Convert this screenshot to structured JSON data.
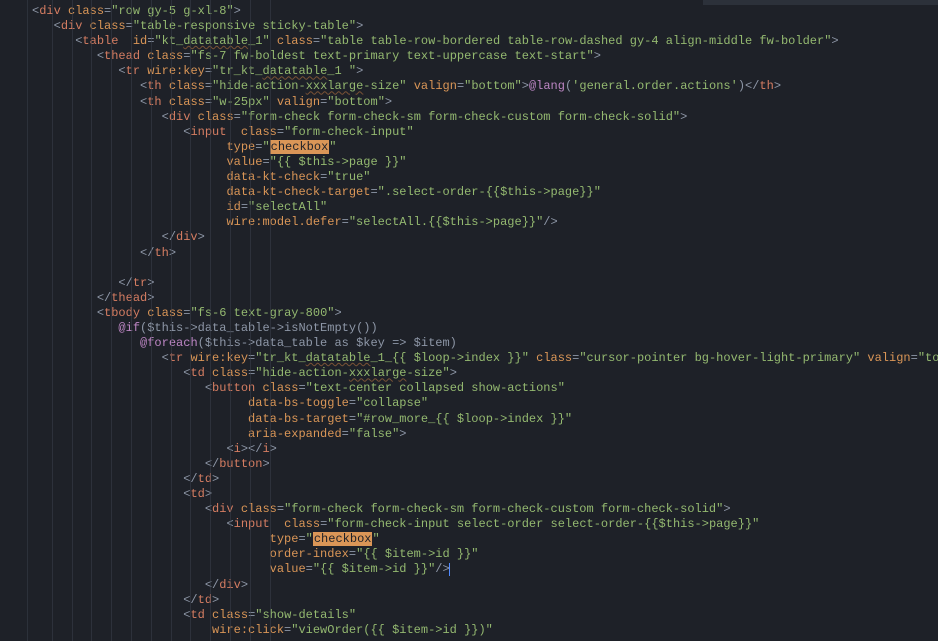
{
  "lines": [
    {
      "i": 0,
      "seg": [
        {
          "c": "p",
          "t": "<"
        },
        {
          "c": "tg",
          "t": "div"
        },
        {
          "c": "p",
          "t": " "
        },
        {
          "c": "at",
          "t": "class"
        },
        {
          "c": "op",
          "t": "="
        },
        {
          "c": "st",
          "t": "\"row gy-5 g-xl-8\""
        },
        {
          "c": "p",
          "t": ">"
        }
      ]
    },
    {
      "i": 1,
      "seg": [
        {
          "c": "p",
          "t": "<"
        },
        {
          "c": "tg",
          "t": "div"
        },
        {
          "c": "p",
          "t": " "
        },
        {
          "c": "at",
          "t": "class"
        },
        {
          "c": "op",
          "t": "="
        },
        {
          "c": "st",
          "t": "\"table-responsive sticky-table\""
        },
        {
          "c": "p",
          "t": ">"
        }
      ]
    },
    {
      "i": 2,
      "seg": [
        {
          "c": "p",
          "t": "<"
        },
        {
          "c": "tg",
          "t": "table"
        },
        {
          "c": "p",
          "t": "  "
        },
        {
          "c": "at",
          "t": "id"
        },
        {
          "c": "op",
          "t": "="
        },
        {
          "c": "st",
          "t": "\"kt_"
        },
        {
          "c": "st wavy",
          "t": "datatable"
        },
        {
          "c": "st",
          "t": "_1\""
        },
        {
          "c": "p",
          "t": " "
        },
        {
          "c": "at",
          "t": "class"
        },
        {
          "c": "op",
          "t": "="
        },
        {
          "c": "st",
          "t": "\"table table-row-bordered table-row-dashed gy-4 align-middle fw-bolder\""
        },
        {
          "c": "p",
          "t": ">"
        }
      ]
    },
    {
      "i": 3,
      "seg": [
        {
          "c": "p",
          "t": "<"
        },
        {
          "c": "tg",
          "t": "thead"
        },
        {
          "c": "p",
          "t": " "
        },
        {
          "c": "at",
          "t": "class"
        },
        {
          "c": "op",
          "t": "="
        },
        {
          "c": "st",
          "t": "\"fs-7 fw-boldest text-primary text-uppercase text-start\""
        },
        {
          "c": "p",
          "t": ">"
        }
      ]
    },
    {
      "i": 4,
      "seg": [
        {
          "c": "p",
          "t": "<"
        },
        {
          "c": "tg",
          "t": "tr"
        },
        {
          "c": "p",
          "t": " "
        },
        {
          "c": "at",
          "t": "wire:key"
        },
        {
          "c": "op",
          "t": "="
        },
        {
          "c": "st",
          "t": "\"tr_kt_"
        },
        {
          "c": "st wavy",
          "t": "datatable"
        },
        {
          "c": "st",
          "t": "_1 \""
        },
        {
          "c": "p",
          "t": ">"
        }
      ]
    },
    {
      "i": 5,
      "seg": [
        {
          "c": "p",
          "t": "<"
        },
        {
          "c": "tg",
          "t": "th"
        },
        {
          "c": "p",
          "t": " "
        },
        {
          "c": "at",
          "t": "class"
        },
        {
          "c": "op",
          "t": "="
        },
        {
          "c": "st",
          "t": "\"hide-action-"
        },
        {
          "c": "st wavy",
          "t": "xxxlarge"
        },
        {
          "c": "st",
          "t": "-size\""
        },
        {
          "c": "p",
          "t": " "
        },
        {
          "c": "at",
          "t": "valign"
        },
        {
          "c": "op",
          "t": "="
        },
        {
          "c": "st",
          "t": "\"bottom\""
        },
        {
          "c": "p",
          "t": ">"
        },
        {
          "c": "bl",
          "t": "@lang"
        },
        {
          "c": "p",
          "t": "("
        },
        {
          "c": "st",
          "t": "'general.order.actions'"
        },
        {
          "c": "p",
          "t": ")</"
        },
        {
          "c": "tg",
          "t": "th"
        },
        {
          "c": "p",
          "t": ">"
        }
      ]
    },
    {
      "i": 5,
      "seg": [
        {
          "c": "p",
          "t": "<"
        },
        {
          "c": "tg",
          "t": "th"
        },
        {
          "c": "p",
          "t": " "
        },
        {
          "c": "at",
          "t": "class"
        },
        {
          "c": "op",
          "t": "="
        },
        {
          "c": "st",
          "t": "\"w-25px\""
        },
        {
          "c": "p",
          "t": " "
        },
        {
          "c": "at",
          "t": "valign"
        },
        {
          "c": "op",
          "t": "="
        },
        {
          "c": "st",
          "t": "\"bottom\""
        },
        {
          "c": "p",
          "t": ">"
        }
      ]
    },
    {
      "i": 6,
      "seg": [
        {
          "c": "p",
          "t": "<"
        },
        {
          "c": "tg",
          "t": "div"
        },
        {
          "c": "p",
          "t": " "
        },
        {
          "c": "at",
          "t": "class"
        },
        {
          "c": "op",
          "t": "="
        },
        {
          "c": "st",
          "t": "\"form-check form-check-sm form-check-custom form-check-solid\""
        },
        {
          "c": "p",
          "t": ">"
        }
      ]
    },
    {
      "i": 7,
      "seg": [
        {
          "c": "p",
          "t": "<"
        },
        {
          "c": "tg",
          "t": "input"
        },
        {
          "c": "p",
          "t": "  "
        },
        {
          "c": "at",
          "t": "class"
        },
        {
          "c": "op",
          "t": "="
        },
        {
          "c": "st",
          "t": "\"form-check-input\""
        }
      ]
    },
    {
      "i": 9,
      "seg": [
        {
          "c": "at",
          "t": "type"
        },
        {
          "c": "op",
          "t": "="
        },
        {
          "c": "st",
          "t": "\""
        },
        {
          "c": "hl",
          "t": "checkbox"
        },
        {
          "c": "st",
          "t": "\""
        }
      ]
    },
    {
      "i": 9,
      "seg": [
        {
          "c": "at",
          "t": "value"
        },
        {
          "c": "op",
          "t": "="
        },
        {
          "c": "st",
          "t": "\"{{ $this->page }}\""
        }
      ]
    },
    {
      "i": 9,
      "seg": [
        {
          "c": "at",
          "t": "data-kt-check"
        },
        {
          "c": "op",
          "t": "="
        },
        {
          "c": "st",
          "t": "\"true\""
        }
      ]
    },
    {
      "i": 9,
      "seg": [
        {
          "c": "at",
          "t": "data-kt-check-target"
        },
        {
          "c": "op",
          "t": "="
        },
        {
          "c": "st",
          "t": "\".select-order-{{$this->page}}\""
        }
      ]
    },
    {
      "i": 9,
      "seg": [
        {
          "c": "at",
          "t": "id"
        },
        {
          "c": "op",
          "t": "="
        },
        {
          "c": "st",
          "t": "\"selectAll\""
        }
      ]
    },
    {
      "i": 9,
      "seg": [
        {
          "c": "at",
          "t": "wire:model.defer"
        },
        {
          "c": "op",
          "t": "="
        },
        {
          "c": "st",
          "t": "\"selectAll.{{$this->page}}\""
        },
        {
          "c": "p",
          "t": "/>"
        }
      ]
    },
    {
      "i": 6,
      "seg": [
        {
          "c": "p",
          "t": "</"
        },
        {
          "c": "tg",
          "t": "div"
        },
        {
          "c": "p",
          "t": ">"
        }
      ]
    },
    {
      "i": 5,
      "seg": [
        {
          "c": "p",
          "t": "</"
        },
        {
          "c": "tg",
          "t": "th"
        },
        {
          "c": "p",
          "t": ">"
        }
      ]
    },
    {
      "i": 0,
      "seg": []
    },
    {
      "i": 4,
      "seg": [
        {
          "c": "p",
          "t": "</"
        },
        {
          "c": "tg",
          "t": "tr"
        },
        {
          "c": "p",
          "t": ">"
        }
      ]
    },
    {
      "i": 3,
      "seg": [
        {
          "c": "p",
          "t": "</"
        },
        {
          "c": "tg",
          "t": "thead"
        },
        {
          "c": "p",
          "t": ">"
        }
      ]
    },
    {
      "i": 3,
      "seg": [
        {
          "c": "p",
          "t": "<"
        },
        {
          "c": "tg",
          "t": "tbody"
        },
        {
          "c": "p",
          "t": " "
        },
        {
          "c": "at",
          "t": "class"
        },
        {
          "c": "op",
          "t": "="
        },
        {
          "c": "st",
          "t": "\"fs-6 text-gray-800\""
        },
        {
          "c": "p",
          "t": ">"
        }
      ]
    },
    {
      "i": 4,
      "seg": [
        {
          "c": "bl",
          "t": "@if"
        },
        {
          "c": "p",
          "t": "($this->data_table->isNotEmpty())"
        }
      ]
    },
    {
      "i": 5,
      "seg": [
        {
          "c": "bl",
          "t": "@foreach"
        },
        {
          "c": "p",
          "t": "($this->data_table as $key => $item)"
        }
      ]
    },
    {
      "i": 6,
      "seg": [
        {
          "c": "p",
          "t": "<"
        },
        {
          "c": "tg",
          "t": "tr"
        },
        {
          "c": "p",
          "t": " "
        },
        {
          "c": "at",
          "t": "wire:key"
        },
        {
          "c": "op",
          "t": "="
        },
        {
          "c": "st",
          "t": "\"tr_kt_"
        },
        {
          "c": "st wavy",
          "t": "datatable"
        },
        {
          "c": "st",
          "t": "_1_{{ $loop->index }}\""
        },
        {
          "c": "p",
          "t": " "
        },
        {
          "c": "at",
          "t": "class"
        },
        {
          "c": "op",
          "t": "="
        },
        {
          "c": "st",
          "t": "\"cursor-pointer bg-hover-light-primary\""
        },
        {
          "c": "p",
          "t": " "
        },
        {
          "c": "at",
          "t": "valign"
        },
        {
          "c": "op",
          "t": "="
        },
        {
          "c": "st",
          "t": "\"top\""
        },
        {
          "c": "p",
          "t": ">"
        }
      ]
    },
    {
      "i": 7,
      "seg": [
        {
          "c": "p",
          "t": "<"
        },
        {
          "c": "tg",
          "t": "td"
        },
        {
          "c": "p",
          "t": " "
        },
        {
          "c": "at",
          "t": "class"
        },
        {
          "c": "op",
          "t": "="
        },
        {
          "c": "st",
          "t": "\"hide-action-"
        },
        {
          "c": "st wavy",
          "t": "xxxlarge"
        },
        {
          "c": "st",
          "t": "-size\""
        },
        {
          "c": "p",
          "t": ">"
        }
      ]
    },
    {
      "i": 8,
      "seg": [
        {
          "c": "p",
          "t": "<"
        },
        {
          "c": "tg",
          "t": "button"
        },
        {
          "c": "p",
          "t": " "
        },
        {
          "c": "at",
          "t": "class"
        },
        {
          "c": "op",
          "t": "="
        },
        {
          "c": "st",
          "t": "\"text-center collapsed show-actions\""
        }
      ]
    },
    {
      "i": 10,
      "seg": [
        {
          "c": "at",
          "t": "data-bs-toggle"
        },
        {
          "c": "op",
          "t": "="
        },
        {
          "c": "st",
          "t": "\"collapse\""
        }
      ]
    },
    {
      "i": 10,
      "seg": [
        {
          "c": "at",
          "t": "data-bs-target"
        },
        {
          "c": "op",
          "t": "="
        },
        {
          "c": "st",
          "t": "\"#row_more_{{ $loop->index }}\""
        }
      ]
    },
    {
      "i": 10,
      "seg": [
        {
          "c": "at",
          "t": "aria-expanded"
        },
        {
          "c": "op",
          "t": "="
        },
        {
          "c": "st",
          "t": "\"false\""
        },
        {
          "c": "p",
          "t": ">"
        }
      ]
    },
    {
      "i": 9,
      "seg": [
        {
          "c": "p",
          "t": "<"
        },
        {
          "c": "tg",
          "t": "i"
        },
        {
          "c": "p",
          "t": "></"
        },
        {
          "c": "tg",
          "t": "i"
        },
        {
          "c": "p",
          "t": ">"
        }
      ]
    },
    {
      "i": 8,
      "seg": [
        {
          "c": "p",
          "t": "</"
        },
        {
          "c": "tg",
          "t": "button"
        },
        {
          "c": "p",
          "t": ">"
        }
      ]
    },
    {
      "i": 7,
      "seg": [
        {
          "c": "p",
          "t": "</"
        },
        {
          "c": "tg",
          "t": "td"
        },
        {
          "c": "p",
          "t": ">"
        }
      ]
    },
    {
      "i": 7,
      "seg": [
        {
          "c": "p",
          "t": "<"
        },
        {
          "c": "tg",
          "t": "td"
        },
        {
          "c": "p",
          "t": ">"
        }
      ]
    },
    {
      "i": 8,
      "seg": [
        {
          "c": "p",
          "t": "<"
        },
        {
          "c": "tg",
          "t": "div"
        },
        {
          "c": "p",
          "t": " "
        },
        {
          "c": "at",
          "t": "class"
        },
        {
          "c": "op",
          "t": "="
        },
        {
          "c": "st",
          "t": "\"form-check form-check-sm form-check-custom form-check-solid\""
        },
        {
          "c": "p",
          "t": ">"
        }
      ]
    },
    {
      "i": 9,
      "seg": [
        {
          "c": "p",
          "t": "<"
        },
        {
          "c": "tg",
          "t": "input"
        },
        {
          "c": "p",
          "t": "  "
        },
        {
          "c": "at",
          "t": "class"
        },
        {
          "c": "op",
          "t": "="
        },
        {
          "c": "st",
          "t": "\"form-check-input select-order select-order-{{$this->page}}\""
        }
      ]
    },
    {
      "i": 11,
      "seg": [
        {
          "c": "at",
          "t": "type"
        },
        {
          "c": "op",
          "t": "="
        },
        {
          "c": "st",
          "t": "\""
        },
        {
          "c": "hl",
          "t": "checkbox"
        },
        {
          "c": "st",
          "t": "\""
        }
      ]
    },
    {
      "i": 11,
      "seg": [
        {
          "c": "at",
          "t": "order-index"
        },
        {
          "c": "op",
          "t": "="
        },
        {
          "c": "st",
          "t": "\"{{ $item->id }}\""
        }
      ]
    },
    {
      "i": 11,
      "seg": [
        {
          "c": "at",
          "t": "value"
        },
        {
          "c": "op",
          "t": "="
        },
        {
          "c": "st",
          "t": "\"{{ $item->id }}\""
        },
        {
          "c": "p",
          "t": "/>"
        },
        {
          "c": "cur",
          "t": ""
        }
      ]
    },
    {
      "i": 8,
      "seg": [
        {
          "c": "p",
          "t": "</"
        },
        {
          "c": "tg",
          "t": "div"
        },
        {
          "c": "p",
          "t": ">"
        }
      ]
    },
    {
      "i": 7,
      "seg": [
        {
          "c": "p",
          "t": "</"
        },
        {
          "c": "tg",
          "t": "td"
        },
        {
          "c": "p",
          "t": ">"
        }
      ]
    },
    {
      "i": 7,
      "seg": [
        {
          "c": "p",
          "t": "<"
        },
        {
          "c": "tg",
          "t": "td"
        },
        {
          "c": "p",
          "t": " "
        },
        {
          "c": "at",
          "t": "class"
        },
        {
          "c": "op",
          "t": "="
        },
        {
          "c": "st",
          "t": "\"show-details\""
        }
      ]
    },
    {
      "i": 8,
      "seg": [
        {
          "c": "p",
          "t": " "
        },
        {
          "c": "at",
          "t": "wire:click"
        },
        {
          "c": "op",
          "t": "="
        },
        {
          "c": "st",
          "t": "\"viewOrder({{ $item->id }})\""
        }
      ]
    }
  ],
  "indentGuides": [
    8,
    12,
    16,
    20
  ],
  "indentUnit": "   "
}
